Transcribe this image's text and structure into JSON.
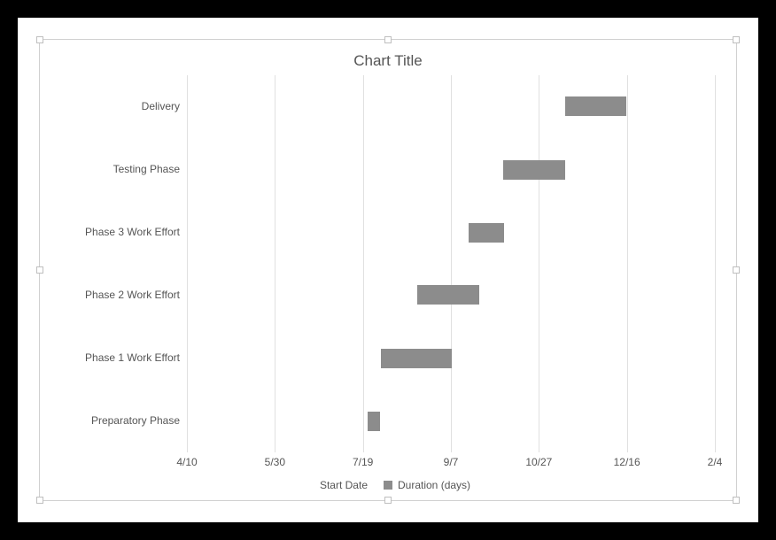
{
  "chart_data": {
    "type": "bar",
    "orientation": "horizontal_stacked_gantt",
    "title": "Chart Title",
    "categories": [
      "Preparatory Phase",
      "Phase 1 Work Effort",
      "Phase 2 Work Effort",
      "Phase 3 Work Effort",
      "Testing Phase",
      "Delivery"
    ],
    "series": [
      {
        "name": "Start Date",
        "values": [
          "7/22",
          "7/29",
          "8/19",
          "9/16",
          "10/6",
          "11/10"
        ]
      },
      {
        "name": "Duration (days)",
        "values": [
          7,
          40,
          35,
          20,
          35,
          35
        ]
      }
    ],
    "x_ticks": [
      "4/10",
      "5/30",
      "7/19",
      "9/7",
      "10/27",
      "12/16",
      "2/4"
    ],
    "xlabel": "",
    "ylabel": "",
    "legend": [
      "Start Date",
      "Duration (days)"
    ]
  },
  "layout": {
    "bars": [
      {
        "key": "Delivery",
        "y_pct": 8.33,
        "left_pct": 71.6,
        "width_pct": 11.7
      },
      {
        "key": "Testing Phase",
        "y_pct": 25.0,
        "left_pct": 59.9,
        "width_pct": 11.7
      },
      {
        "key": "Phase 3 Work Effort",
        "y_pct": 41.67,
        "left_pct": 53.3,
        "width_pct": 6.7
      },
      {
        "key": "Phase 2 Work Effort",
        "y_pct": 58.33,
        "left_pct": 43.6,
        "width_pct": 11.7
      },
      {
        "key": "Phase 1 Work Effort",
        "y_pct": 75.0,
        "left_pct": 36.7,
        "width_pct": 13.4
      },
      {
        "key": "Preparatory Phase",
        "y_pct": 91.67,
        "left_pct": 34.3,
        "width_pct": 2.3
      }
    ],
    "display_categories": [
      "Delivery",
      "Testing Phase",
      "Phase 3 Work Effort",
      "Phase 2 Work Effort",
      "Phase 1 Work Effort",
      "Preparatory Phase"
    ],
    "grid_pct": [
      0,
      16.67,
      33.33,
      50,
      66.67,
      83.33,
      100
    ]
  }
}
